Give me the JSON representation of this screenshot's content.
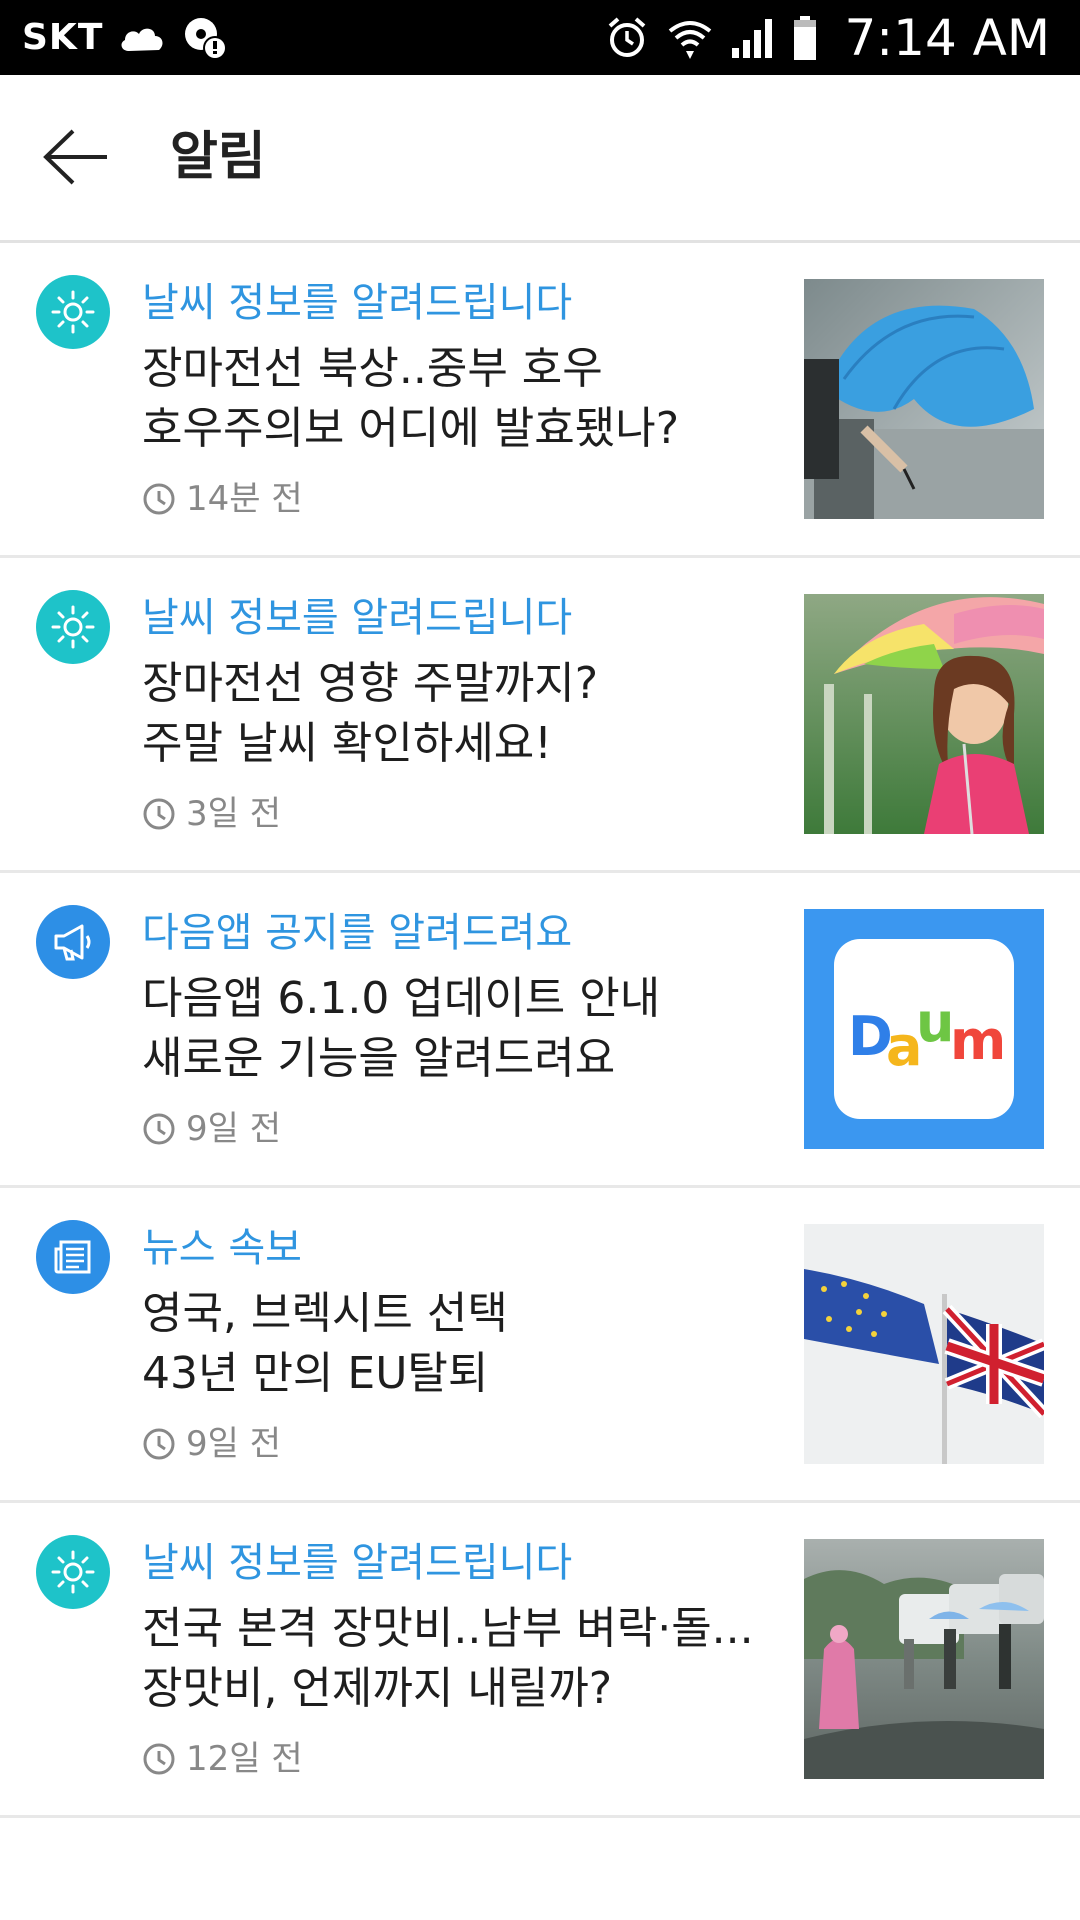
{
  "status_bar": {
    "carrier": "SKT",
    "time": "7:14 AM",
    "icons": [
      "cloud-icon",
      "storage-alert-icon",
      "alarm-icon",
      "wifi-icon",
      "signal-icon",
      "battery-icon"
    ]
  },
  "app_bar": {
    "back_icon": "arrow-left-icon",
    "title": "알림"
  },
  "colors": {
    "category_text": "#2f95e0",
    "weather_icon_bg": "#1ec3c9",
    "notice_icon_bg": "#2d8fe6",
    "news_icon_bg": "#2d8fe6"
  },
  "notifications": [
    {
      "icon": "sun-icon",
      "category": "날씨 정보를 알려드립니다",
      "line1": "장마전선 북상..중부 호우",
      "line2": "호우주의보 어디에 발효됐나?",
      "time": "14분 전",
      "thumbnail": "umbrella-rain-photo"
    },
    {
      "icon": "sun-icon",
      "category": "날씨 정보를 알려드립니다",
      "line1": "장마전선 영향 주말까지?",
      "line2": "주말 날씨 확인하세요!",
      "time": "3일 전",
      "thumbnail": "woman-umbrella-photo"
    },
    {
      "icon": "megaphone-icon",
      "category": "다음앱 공지를 알려드려요",
      "line1": "다음앱 6.1.0 업데이트 안내",
      "line2": "새로운 기능을 알려드려요",
      "time": "9일 전",
      "thumbnail": "daum-logo",
      "logo_text": "Daum"
    },
    {
      "icon": "newspaper-icon",
      "category": "뉴스 속보",
      "line1": "영국, 브렉시트 선택",
      "line2": "43년 만의 EU탈퇴",
      "time": "9일 전",
      "thumbnail": "eu-uk-flags-photo"
    },
    {
      "icon": "sun-icon",
      "category": "날씨 정보를 알려드립니다",
      "line1": "전국 본격 장맛비..남부 벼락·돌...",
      "line2": "장맛비, 언제까지 내릴까?",
      "time": "12일 전",
      "thumbnail": "rainy-street-photo"
    }
  ]
}
